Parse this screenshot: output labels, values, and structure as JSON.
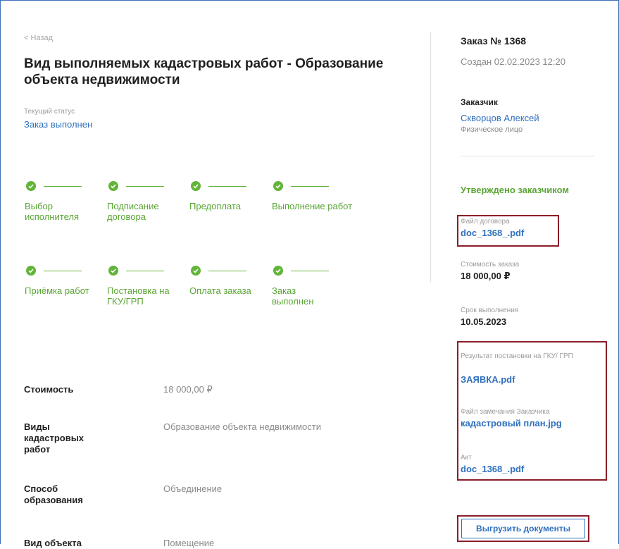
{
  "nav": {
    "back": "< Назад"
  },
  "page": {
    "title": "Вид выполняемых кадастровых работ - Образование объекта недвижимости",
    "status_label": "Текущий статус",
    "status_value": "Заказ выполнен"
  },
  "steps": [
    {
      "label": "Выбор исполнителя",
      "done": true
    },
    {
      "label": "Подписание договора",
      "done": true
    },
    {
      "label": "Предоплата",
      "done": true
    },
    {
      "label": "Выполнение работ",
      "done": true
    },
    {
      "label": "Приёмка работ",
      "done": true
    },
    {
      "label": "Постановка на ГКУ/ГРП",
      "done": true
    },
    {
      "label": "Оплата заказа",
      "done": true
    },
    {
      "label": "Заказ выполнен",
      "done": true
    }
  ],
  "details": [
    {
      "label": "Стоимость",
      "value": "18 000,00 ₽"
    },
    {
      "label": "Виды кадастровых работ",
      "value": "Образование объекта недвижимости"
    },
    {
      "label": "Способ образования",
      "value": "Объединение"
    },
    {
      "label": "Вид объекта",
      "value": "Помещение"
    }
  ],
  "order": {
    "number": "Заказ № 1368",
    "created": "Создан 02.02.2023 12:20",
    "customer_heading": "Заказчик",
    "customer_name": "Скворцов Алексей",
    "customer_type": "Физическое лицо",
    "approved": "Утверждено заказчиком",
    "contract_label": "Файл договора",
    "contract_file": "doc_1368_.pdf",
    "cost_label": "Стоимость заказа",
    "cost_value": "18 000,00 ₽",
    "deadline_label": "Срок выполнения",
    "deadline_value": "10.05.2023",
    "result_label": "Результат постановки на ГКУ/ ГРП",
    "result_file": "ЗАЯВКА.pdf",
    "remarks_label": "Файл замечания Заказчика",
    "remarks_file": "кадастровый план.jpg",
    "act_label": "Акт",
    "act_file": "doc_1368_.pdf",
    "download_button": "Выгрузить документы"
  },
  "colors": {
    "accent": "#2e6fbd",
    "success": "#5aa535",
    "highlight_box": "#8b1e2a"
  }
}
